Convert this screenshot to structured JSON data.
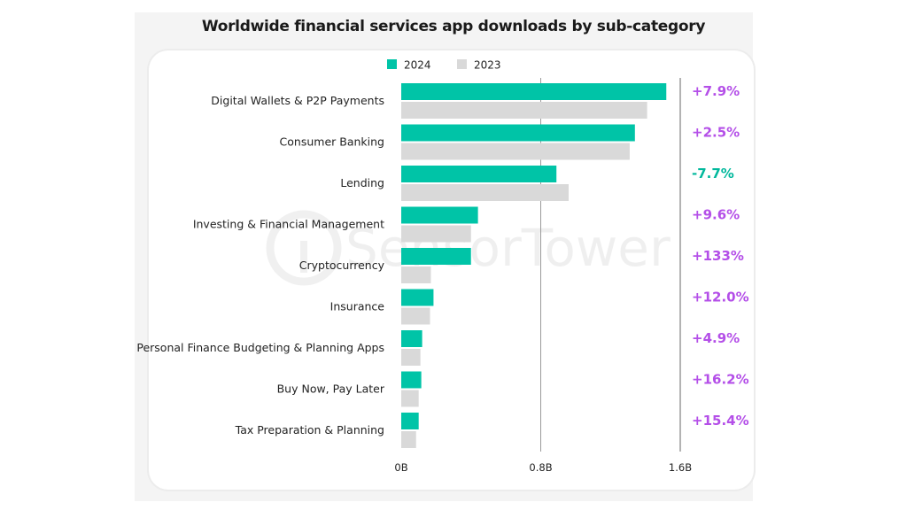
{
  "chart_data": {
    "type": "bar",
    "orientation": "horizontal",
    "title": "Worldwide financial services app downloads by sub-category",
    "xlabel": "",
    "ylabel": "",
    "xlim": [
      0,
      1.6
    ],
    "x_ticks": [
      {
        "value": 0,
        "label": "0B"
      },
      {
        "value": 0.8,
        "label": "0.8B"
      },
      {
        "value": 1.6,
        "label": "1.6B"
      }
    ],
    "unit": "billions of downloads",
    "legend_position": "top-center",
    "categories": [
      "Digital Wallets & P2P Payments",
      "Consumer Banking",
      "Lending",
      "Investing & Financial Management",
      "Cryptocurrency",
      "Insurance",
      "Personal Finance Budgeting & Planning Apps",
      "Buy Now, Pay Later",
      "Tax Preparation & Planning"
    ],
    "series": [
      {
        "name": "2024",
        "color": "#00c4a7",
        "values": [
          1.52,
          1.34,
          0.89,
          0.44,
          0.4,
          0.185,
          0.12,
          0.115,
          0.1
        ]
      },
      {
        "name": "2023",
        "color": "#d9d9d9",
        "values": [
          1.41,
          1.31,
          0.96,
          0.4,
          0.17,
          0.165,
          0.11,
          0.1,
          0.085
        ]
      }
    ],
    "yoy_change": [
      {
        "label": "+7.9%",
        "direction": "up"
      },
      {
        "label": "+2.5%",
        "direction": "up"
      },
      {
        "label": "-7.7%",
        "direction": "down"
      },
      {
        "label": "+9.6%",
        "direction": "up"
      },
      {
        "label": "+133%",
        "direction": "up"
      },
      {
        "label": "+12.0%",
        "direction": "up"
      },
      {
        "label": "+4.9%",
        "direction": "up"
      },
      {
        "label": "+16.2%",
        "direction": "up"
      },
      {
        "label": "+15.4%",
        "direction": "up"
      }
    ],
    "change_colors": {
      "up": "#b44fe8",
      "down": "#00b89c"
    },
    "watermark": "SensorTower"
  }
}
